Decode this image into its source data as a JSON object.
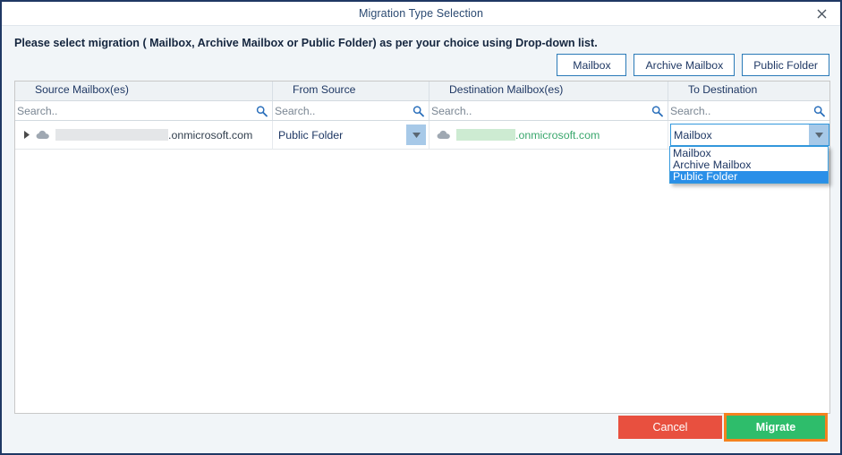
{
  "window": {
    "title": "Migration Type Selection",
    "close_label": "×"
  },
  "instruction": "Please select migration ( Mailbox, Archive Mailbox or Public Folder) as per your choice using Drop-down list.",
  "type_buttons": [
    {
      "label": "Mailbox"
    },
    {
      "label": "Archive Mailbox"
    },
    {
      "label": "Public Folder"
    }
  ],
  "grid": {
    "columns": [
      {
        "header": "Source Mailbox(es)",
        "search_placeholder": "Search.."
      },
      {
        "header": "From Source",
        "search_placeholder": "Search.."
      },
      {
        "header": "Destination Mailbox(es)",
        "search_placeholder": "Search.."
      },
      {
        "header": "To Destination",
        "search_placeholder": "Search.."
      }
    ],
    "search_values": [
      "",
      "",
      "",
      ""
    ],
    "row": {
      "source_suffix": ".onmicrosoft.com",
      "from_source_value": "Public Folder",
      "destination_suffix": ".onmicrosoft.com",
      "to_destination_value": "Mailbox"
    }
  },
  "dropdown": {
    "options": [
      "Mailbox",
      "Archive Mailbox",
      "Public Folder"
    ],
    "highlighted": "Public Folder"
  },
  "footer": {
    "cancel_label": "Cancel",
    "migrate_label": "Migrate"
  },
  "colors": {
    "dialog_border": "#1f3864",
    "accent_blue": "#3399dd",
    "highlight_blue": "#2a8fe8",
    "cancel_red": "#e8503f",
    "migrate_green": "#2ebd6b",
    "focus_orange": "#f58220",
    "green_text": "#3aa76d"
  }
}
